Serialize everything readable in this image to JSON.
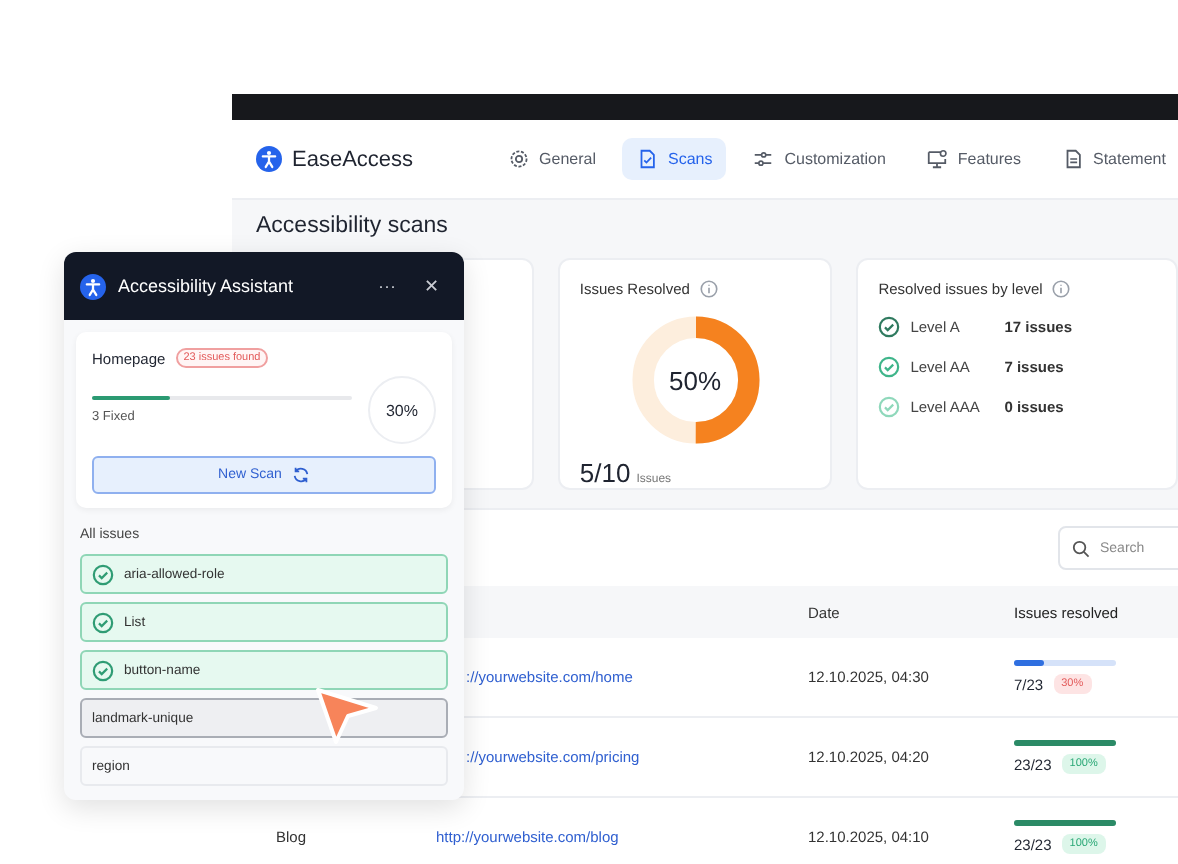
{
  "app": {
    "brand": "EaseAccess"
  },
  "nav": [
    {
      "label": "General",
      "selected": false
    },
    {
      "label": "Scans",
      "selected": true
    },
    {
      "label": "Customization",
      "selected": false
    },
    {
      "label": "Features",
      "selected": false
    },
    {
      "label": "Statement",
      "selected": false
    }
  ],
  "heading": "Accessibility scans",
  "resolved_card": {
    "title": "Issues Resolved",
    "level": 0.5,
    "reading": "50%",
    "count": "5/10",
    "unit": "Issues"
  },
  "levels_card": {
    "title": "Resolved issues by level",
    "items": [
      {
        "label": "Level A",
        "count": "17 issues",
        "color": "#2f7a5f"
      },
      {
        "label": "Level AA",
        "count": "7 issues",
        "color": "#3fb58a"
      },
      {
        "label": "Level AAA",
        "count": "0 issues",
        "color": "#8fd8bb"
      }
    ]
  },
  "search": {
    "placeholder": "Search"
  },
  "table": {
    "columns": [
      "Date",
      "Issues resolved"
    ],
    "rows": [
      {
        "url": "://yourwebsite.com/home",
        "date": "12.10.2025, 04:30",
        "resolved": "7/23",
        "level": 0.3,
        "badge": "30%",
        "kind": "partial"
      },
      {
        "url": "://yourwebsite.com/pricing",
        "date": "12.10.2025, 04:20",
        "resolved": "23/23",
        "level": 1,
        "badge": "100%",
        "kind": "complete"
      },
      {
        "page": "Blog",
        "url": "http://yourwebsite.com/blog",
        "date": "12.10.2025, 04:10",
        "resolved": "23/23",
        "level": 1,
        "badge": "100%",
        "kind": "complete"
      }
    ]
  },
  "assistant": {
    "title": "Accessibility Assistant",
    "menu": "···",
    "close": "✕",
    "page": "Homepage",
    "badge": "23 issues found",
    "level": 0.3,
    "fixed": "3 Fixed",
    "percent": "30%",
    "scan_button": "New Scan",
    "issues_label": "All issues",
    "issues": [
      {
        "label": "aria-allowed-role",
        "fixed": true,
        "selected": false
      },
      {
        "label": "List",
        "fixed": true,
        "selected": false
      },
      {
        "label": "button-name",
        "fixed": true,
        "selected": false
      },
      {
        "label": "landmark-unique",
        "fixed": false,
        "selected": true
      },
      {
        "label": "region",
        "fixed": false,
        "selected": false
      }
    ]
  }
}
